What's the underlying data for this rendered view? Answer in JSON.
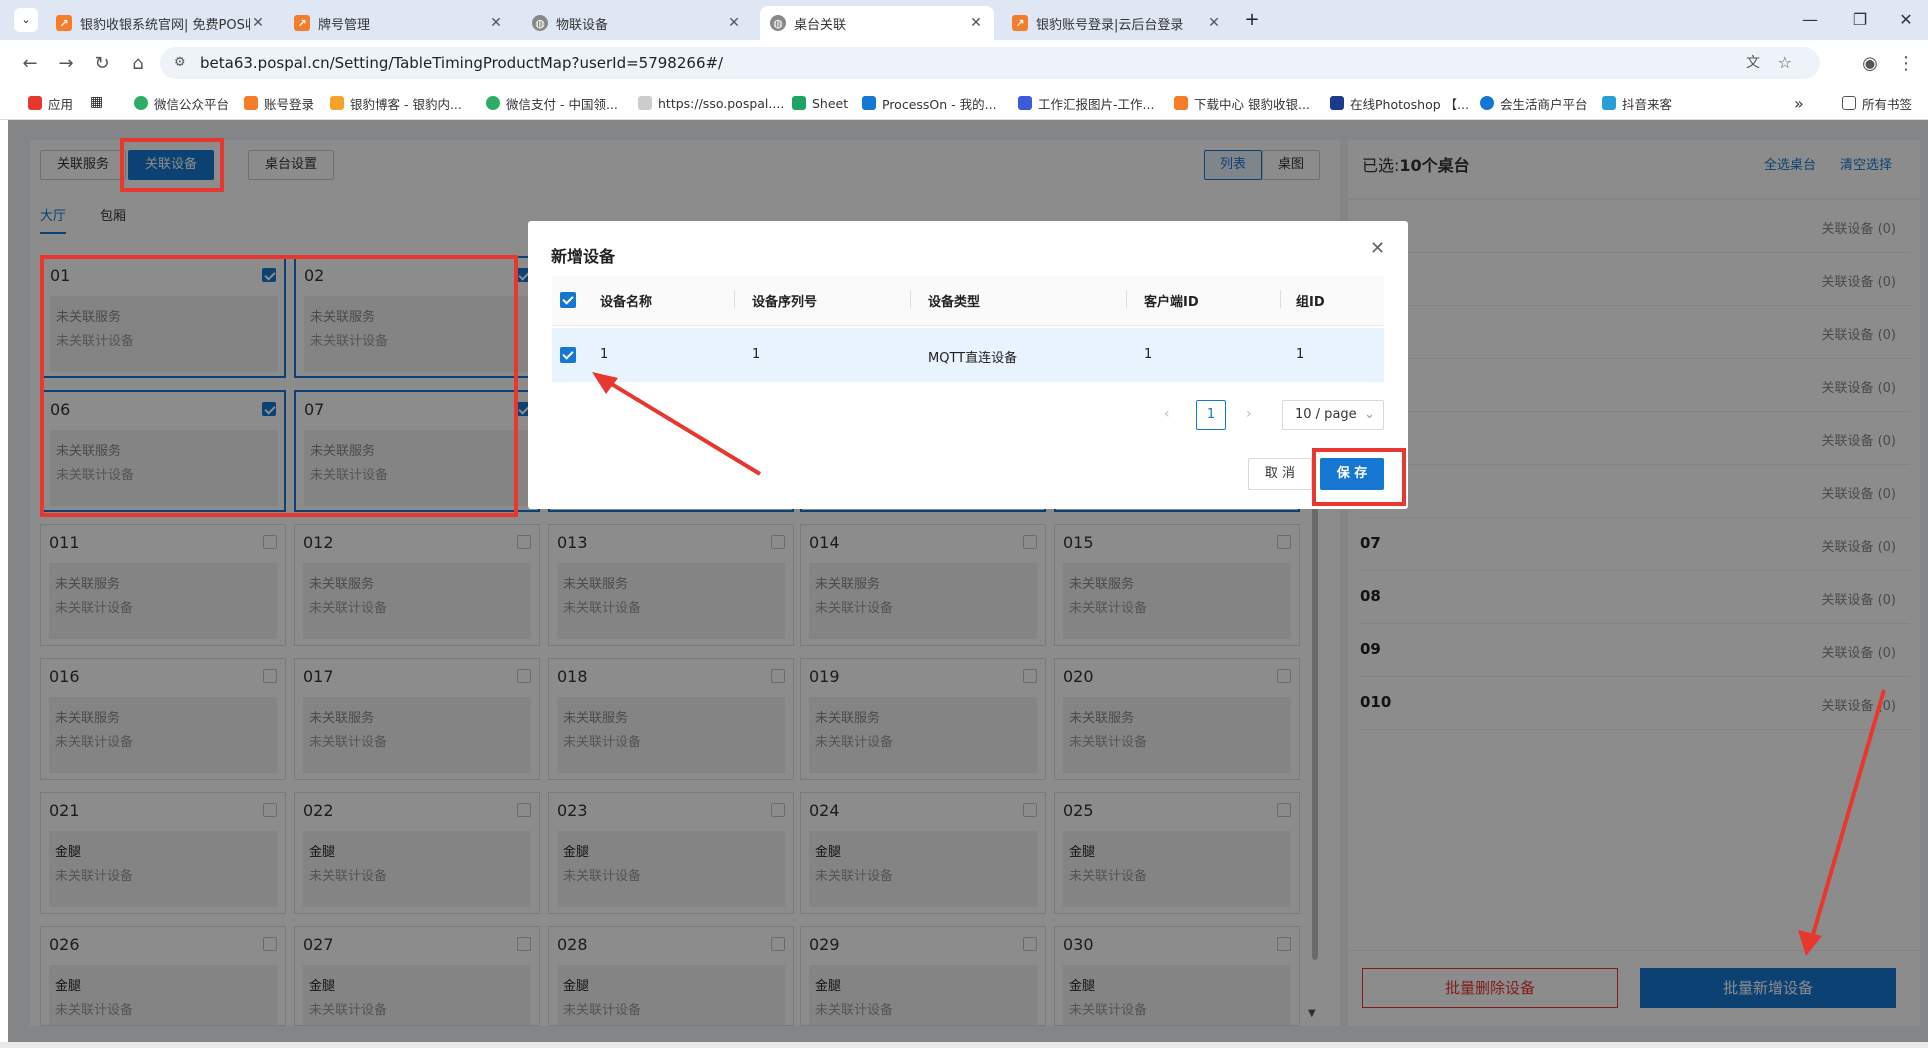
{
  "browser": {
    "tabs": [
      {
        "title": "银豹收银系统官网| 免费POS收",
        "fav_color": "#f57c2a",
        "active": false
      },
      {
        "title": "牌号管理",
        "fav_color": "#f57c2a",
        "active": false
      },
      {
        "title": "物联设备",
        "fav_color": "#666666",
        "active": false
      },
      {
        "title": "桌台关联",
        "fav_color": "#666666",
        "active": true
      },
      {
        "title": "银豹账号登录|云后台登录",
        "fav_color": "#f57c2a",
        "active": false
      }
    ],
    "url": "beta63.pospal.cn/Setting/TableTimingProductMap?userId=5798266#/",
    "bookmarks": [
      "应用",
      "微信公众平台",
      "账号登录",
      "银豹博客 - 银豹内...",
      "微信支付 - 中国领...",
      "https://sso.pospal....",
      "Sheet",
      "ProcessOn - 我的...",
      "工作汇报图片-工作...",
      "下载中心 银豹收银...",
      "在线Photoshop 【...",
      "会生活商户平台",
      "抖音来客"
    ],
    "bookmarks_folder": "所有书签",
    "more": "»"
  },
  "toolbar": {
    "assoc_service": "关联服务",
    "assoc_device": "关联设备",
    "table_settings": "桌台设置",
    "view_list": "列表",
    "view_table": "桌图"
  },
  "areas": {
    "hall": "大厅",
    "room": "包厢"
  },
  "tables": [
    {
      "id": "01",
      "l1": "未关联服务",
      "l2": "未关联计设备",
      "checked": true
    },
    {
      "id": "02",
      "l1": "未关联服务",
      "l2": "未关联计设备",
      "checked": true
    },
    {
      "id": "06",
      "l1": "未关联服务",
      "l2": "未关联计设备",
      "checked": true
    },
    {
      "id": "07",
      "l1": "未关联服务",
      "l2": "未关联计设备",
      "checked": true
    },
    {
      "id": "011",
      "l1": "未关联服务",
      "l2": "未关联计设备",
      "checked": false
    },
    {
      "id": "012",
      "l1": "未关联服务",
      "l2": "未关联计设备",
      "checked": false
    },
    {
      "id": "013",
      "l1": "未关联服务",
      "l2": "未关联计设备",
      "checked": false
    },
    {
      "id": "014",
      "l1": "未关联服务",
      "l2": "未关联计设备",
      "checked": false
    },
    {
      "id": "015",
      "l1": "未关联服务",
      "l2": "未关联计设备",
      "checked": false
    },
    {
      "id": "016",
      "l1": "未关联服务",
      "l2": "未关联计设备",
      "checked": false
    },
    {
      "id": "017",
      "l1": "未关联服务",
      "l2": "未关联计设备",
      "checked": false
    },
    {
      "id": "018",
      "l1": "未关联服务",
      "l2": "未关联计设备",
      "checked": false
    },
    {
      "id": "019",
      "l1": "未关联服务",
      "l2": "未关联计设备",
      "checked": false
    },
    {
      "id": "020",
      "l1": "未关联服务",
      "l2": "未关联计设备",
      "checked": false
    },
    {
      "id": "021",
      "l1": "金腿",
      "l2": "未关联计设备",
      "checked": false
    },
    {
      "id": "022",
      "l1": "金腿",
      "l2": "未关联计设备",
      "checked": false
    },
    {
      "id": "023",
      "l1": "金腿",
      "l2": "未关联计设备",
      "checked": false
    },
    {
      "id": "024",
      "l1": "金腿",
      "l2": "未关联计设备",
      "checked": false
    },
    {
      "id": "025",
      "l1": "金腿",
      "l2": "未关联计设备",
      "checked": false
    },
    {
      "id": "026",
      "l1": "金腿",
      "l2": "未关联计设备",
      "checked": false
    },
    {
      "id": "027",
      "l1": "金腿",
      "l2": "未关联计设备",
      "checked": false
    },
    {
      "id": "028",
      "l1": "金腿",
      "l2": "未关联计设备",
      "checked": false
    },
    {
      "id": "029",
      "l1": "金腿",
      "l2": "未关联计设备",
      "checked": false
    },
    {
      "id": "030",
      "l1": "金腿",
      "l2": "未关联计设备",
      "checked": false
    }
  ],
  "right": {
    "selected_prefix": "已选:",
    "selected_count": "10个桌台",
    "select_all": "全选桌台",
    "clear": "清空选择",
    "rows": [
      {
        "id": "",
        "count": "关联设备 (0)"
      },
      {
        "id": "",
        "count": "关联设备 (0)"
      },
      {
        "id": "",
        "count": "关联设备 (0)"
      },
      {
        "id": "",
        "count": "关联设备 (0)"
      },
      {
        "id": "",
        "count": "关联设备 (0)"
      },
      {
        "id": "",
        "count": "关联设备 (0)"
      },
      {
        "id": "07",
        "count": "关联设备 (0)"
      },
      {
        "id": "08",
        "count": "关联设备 (0)"
      },
      {
        "id": "09",
        "count": "关联设备 (0)"
      },
      {
        "id": "010",
        "count": "关联设备 (0)"
      }
    ],
    "batch_delete": "批量删除设备",
    "batch_add": "批量新增设备"
  },
  "modal": {
    "title": "新增设备",
    "columns": [
      "设备名称",
      "设备序列号",
      "设备类型",
      "客户端ID",
      "组ID"
    ],
    "row": [
      "1",
      "1",
      "MQTT直连设备",
      "1",
      "1"
    ],
    "page": "1",
    "page_size": "10 / page",
    "cancel": "取 消",
    "save": "保 存"
  },
  "colors": {
    "accent": "#1677d2",
    "annotation": "#e8372f"
  }
}
